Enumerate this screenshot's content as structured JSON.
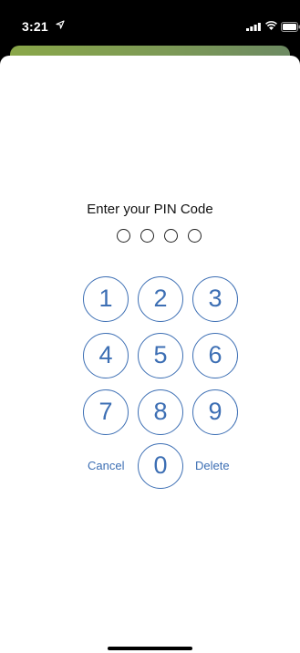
{
  "status_bar": {
    "time": "3:21",
    "icons": [
      "location-arrow-icon",
      "signal-icon",
      "wifi-icon",
      "battery-icon"
    ]
  },
  "pin_screen": {
    "prompt": "Enter your PIN Code",
    "pin_length": 4,
    "filled_digits": 0,
    "keys": [
      "1",
      "2",
      "3",
      "4",
      "5",
      "6",
      "7",
      "8",
      "9",
      "0"
    ],
    "cancel_label": "Cancel",
    "delete_label": "Delete"
  },
  "colors": {
    "accent": "#3d6fb4",
    "header_green": "#8aa749",
    "background": "#ffffff",
    "status_bar": "#000000"
  }
}
